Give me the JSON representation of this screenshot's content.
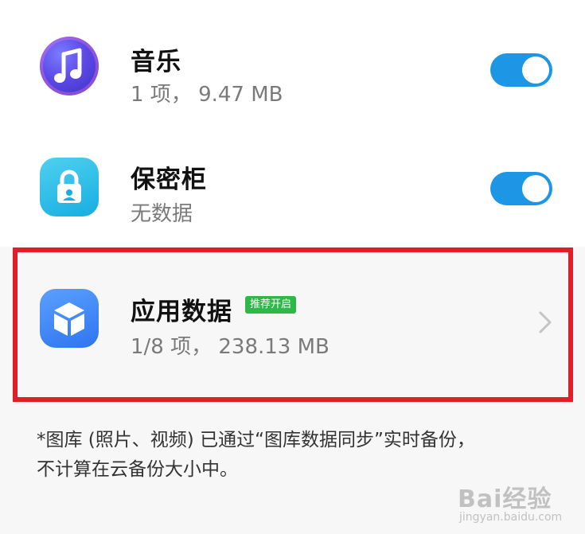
{
  "items": [
    {
      "title": "音乐",
      "subtitle": "1 项， 9.47 MB",
      "icon": "music-note-icon",
      "toggle_on": true
    },
    {
      "title": "保密柜",
      "subtitle": "无数据",
      "icon": "lock-icon",
      "toggle_on": true
    },
    {
      "title": "应用数据",
      "badge": "推荐开启",
      "subtitle": "1/8 项， 238.13 MB",
      "icon": "cube-icon",
      "chevron": "chevron-right-icon"
    }
  ],
  "footnote": {
    "line1": "*图库 (照片、视频) 已通过“图库数据同步”实时备份，",
    "line2": "不计算在云备份大小中。"
  },
  "watermark": {
    "brand": "Bai经验",
    "url": "jingyan.baidu.com"
  },
  "colors": {
    "toggle_on": "#1e96e6",
    "badge": "#2fb84a",
    "highlight": "#e01e26"
  }
}
